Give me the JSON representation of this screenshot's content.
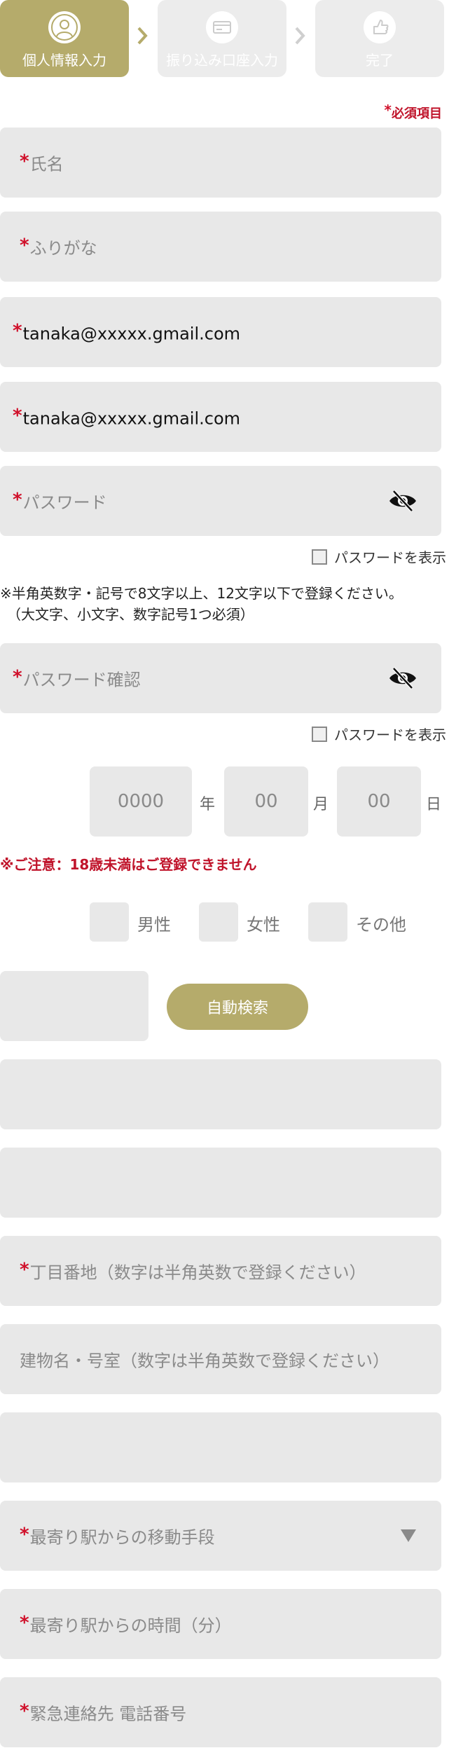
{
  "steps": [
    {
      "label": "個人情報入力",
      "icon": "person-icon",
      "active": true
    },
    {
      "label": "振り込み口座入力",
      "icon": "bank-card-icon",
      "active": false
    },
    {
      "label": "完了",
      "icon": "thumbs-up-icon",
      "active": false
    }
  ],
  "required_note": {
    "asterisk": "*",
    "text": "必須項目"
  },
  "fields": {
    "name": {
      "asterisk": "*",
      "placeholder": "氏名"
    },
    "furigana": {
      "asterisk": "*",
      "placeholder": "ふりがな"
    },
    "email": {
      "asterisk": "*",
      "value": "tanaka@xxxxx.gmail.com"
    },
    "email_confirm": {
      "asterisk": "*",
      "value": "tanaka@xxxxx.gmail.com"
    },
    "password": {
      "asterisk": "*",
      "placeholder": "パスワード"
    },
    "password_confirm": {
      "asterisk": "*",
      "placeholder": "パスワード確認"
    },
    "address_block": {
      "asterisk": "*",
      "placeholder": "丁目番地（数字は半角英数で登録ください）"
    },
    "building": {
      "placeholder": "建物名・号室（数字は半角英数で登録ください）"
    },
    "transport": {
      "asterisk": "*",
      "placeholder": "最寄り駅からの移動手段"
    },
    "station_time": {
      "asterisk": "*",
      "placeholder": "最寄り駅からの時間（分）"
    },
    "emergency_phone": {
      "asterisk": "*",
      "placeholder": "緊急連絡先 電話番号"
    }
  },
  "show_password_label": "パスワードを表示",
  "password_note": "※半角英数字・記号で8文字以上、12文字以下で登録ください。\n　（大文字、小文字、数字記号1つ必須）",
  "birthdate": {
    "year_placeholder": "0000",
    "year_unit": "年",
    "month_placeholder": "00",
    "month_unit": "月",
    "day_placeholder": "00",
    "day_unit": "日"
  },
  "age_warning": "※ご注意：18歳未満はご登録できません",
  "gender": {
    "male": "男性",
    "female": "女性",
    "other": "その他"
  },
  "auto_search_label": "自動検索",
  "colors": {
    "accent": "#b5ab6b",
    "required": "#d0102a",
    "field_bg": "#e8e8e8"
  }
}
